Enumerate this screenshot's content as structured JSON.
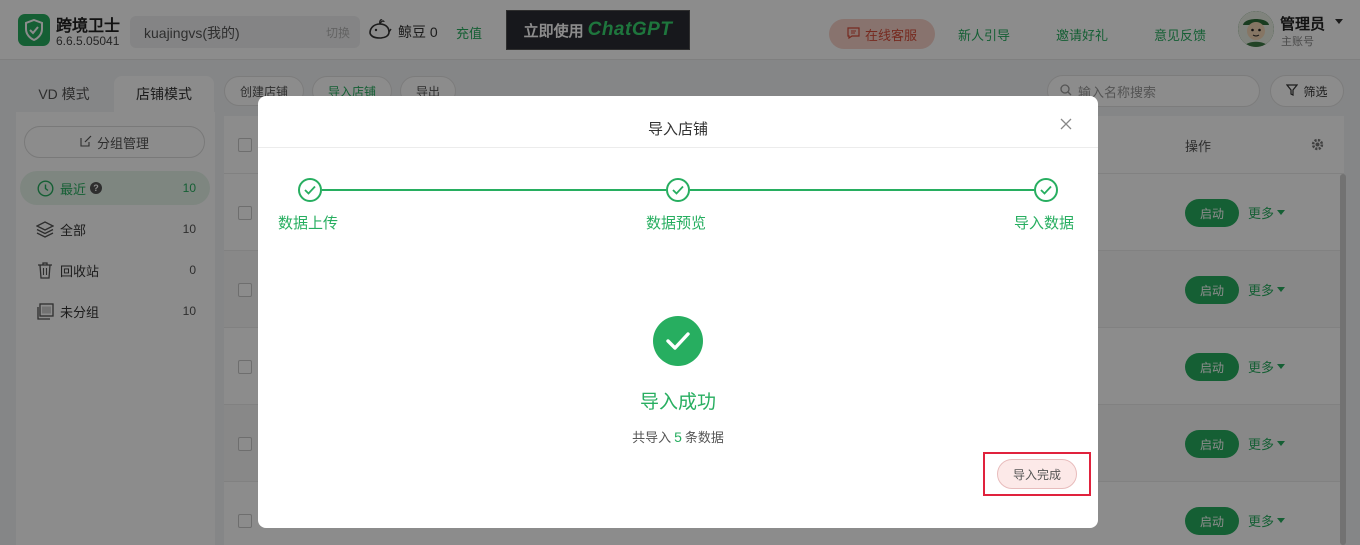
{
  "header": {
    "app_name": "跨境卫士",
    "app_version": "6.6.5.05041",
    "account_name": "kuajingvs(我的)",
    "account_switch": "切换",
    "beans_label": "鲸豆",
    "beans_count": "0",
    "recharge": "充值",
    "banner_cn": "立即使用",
    "banner_en": "ChatGPT",
    "service": "在线客服",
    "nav": [
      "新人引导",
      "邀请好礼",
      "意见反馈"
    ],
    "user_name": "管理员",
    "user_role": "主账号"
  },
  "tabs": [
    "VD 模式",
    "店铺模式"
  ],
  "sidebar": {
    "group_manage": "分组管理",
    "items": [
      {
        "label": "最近",
        "count": "10"
      },
      {
        "label": "全部",
        "count": "10"
      },
      {
        "label": "回收站",
        "count": "0"
      },
      {
        "label": "未分组",
        "count": "10"
      }
    ]
  },
  "toolbar": {
    "create": "创建店铺",
    "import": "导入店铺",
    "export": "导出",
    "search_placeholder": "输入名称搜索",
    "filter": "筛选"
  },
  "table": {
    "action_header": "操作",
    "start_label": "启动",
    "more_label": "更多"
  },
  "modal": {
    "title": "导入店铺",
    "steps": [
      "数据上传",
      "数据预览",
      "导入数据"
    ],
    "success_title": "导入成功",
    "success_prefix": "共导入",
    "success_count": "5",
    "success_suffix": "条数据",
    "done_button": "导入完成"
  },
  "colors": {
    "brand_green": "#27ae60",
    "service_red": "#d84e3b",
    "highlight_red": "#e0223d"
  }
}
